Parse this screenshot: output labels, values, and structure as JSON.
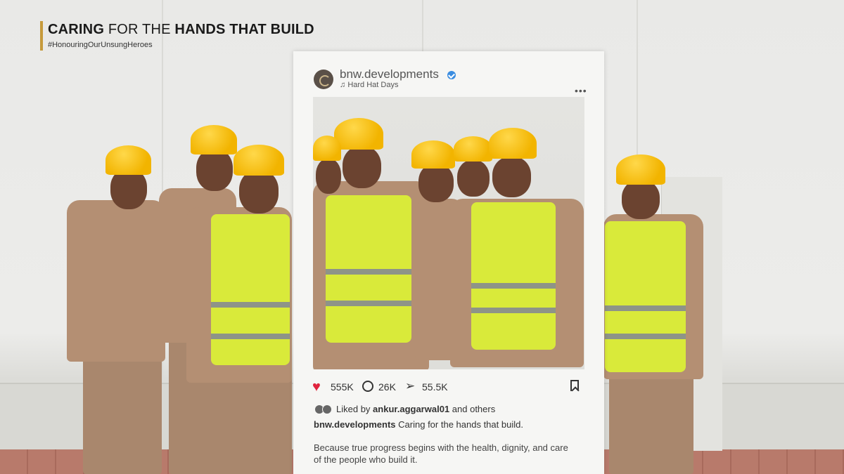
{
  "header": {
    "title_part1": "CARING",
    "title_part2": " FOR THE ",
    "title_part3": "HANDS THAT BUILD",
    "hashtag": "#HonouringOurUnsungHeroes",
    "accent_color": "#c69a3b"
  },
  "post": {
    "handle": "bnw.developments",
    "music": "Hard Hat Days",
    "likes": "555K",
    "comments": "26K",
    "shares": "55.5K",
    "liked_by_prefix": "Liked by ",
    "liked_by_user": "ankur.aggarwal01",
    "liked_by_suffix": " and others",
    "caption_handle": "bnw.developments",
    "caption_text": " Caring for the hands that build.",
    "body": "Because true progress begins with the health, dignity, and care of the people who build it.",
    "more_icon": "more-dots-icon",
    "heart_color": "#e0243e",
    "verified_color": "#3b8de0"
  }
}
